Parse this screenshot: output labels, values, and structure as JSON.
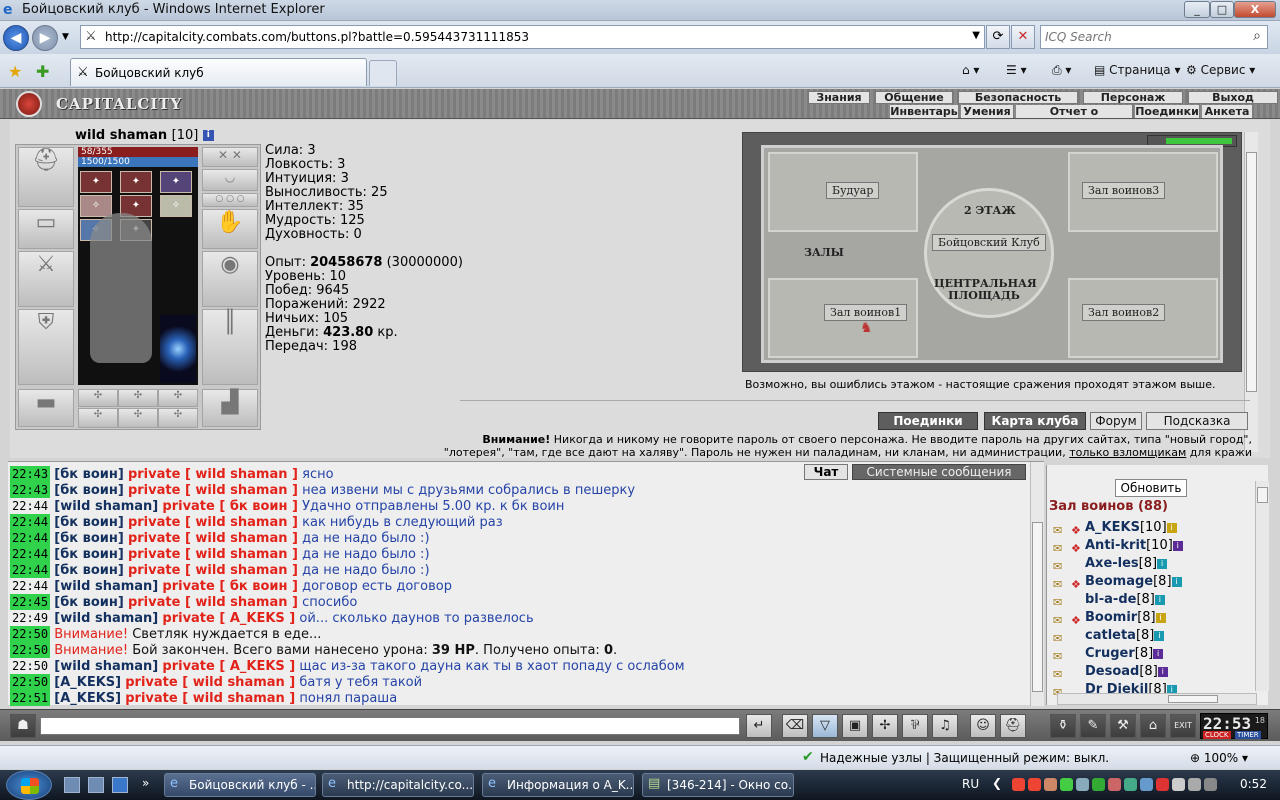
{
  "window": {
    "title": "Бойцовский клуб - Windows Internet Explorer",
    "min": "_",
    "max": "□",
    "close": "X"
  },
  "browser": {
    "url": "http://capitalcity.combats.com/buttons.pl?battle=0.595443731111853",
    "search_placeholder": "ICQ Search",
    "tab_label": "Бойцовский клуб",
    "cmd_page": "Страница",
    "cmd_service": "Сервис",
    "status_text": "Надежные узлы | Защищенный режим: выкл.",
    "zoom": "100%"
  },
  "game": {
    "logo_text": "CAPITALCITY",
    "top_menu": [
      "Знания",
      "Общение",
      "Безопасность",
      "Персонаж",
      "Выход"
    ],
    "sub_menu": [
      "Инвентарь",
      "Умения",
      "Отчет о переводах",
      "Поединки",
      "Анкета"
    ],
    "character": {
      "name": "wild shaman",
      "level": "[10]",
      "hp": "58/355",
      "mp": "1500/1500"
    },
    "stats": {
      "strength": "Сила: 3",
      "agility": "Ловкость: 3",
      "intuition": "Интуиция: 3",
      "endurance": "Выносливость: 25",
      "intellect": "Интеллект: 35",
      "wisdom": "Мудрость: 125",
      "spirit": "Духовность: 0",
      "exp_label": "Опыт: ",
      "exp_value": "20458678",
      "exp_next": " (30000000)",
      "level": "Уровень: 10",
      "wins": "Побед: 9645",
      "losses": "Поражений: 2922",
      "draws": "Ничьих: 105",
      "money_label": "Деньги: ",
      "money_value": "423.80",
      "money_unit": " кр.",
      "transfers": "Передач: 198"
    },
    "map": {
      "boudoir": "Будуар",
      "hall3": "Зал воинов3",
      "floor": "2 ЭТАЖ",
      "club": "Бойцовский Клуб",
      "halls": "ЗАЛЫ",
      "central": "ЦЕНТРАЛЬНАЯ ПЛОЩАДЬ",
      "hall1": "Зал воинов1",
      "hall2": "Зал воинов2",
      "note": "Возможно, вы ошиблись этажом - настоящие сражения проходят этажом выше."
    },
    "buttons": {
      "duels": "Поединки",
      "club_map": "Карта клуба",
      "forum": "Форум",
      "hint": "Подсказка"
    },
    "warning": {
      "bold": "Внимание!",
      "line1": " Никогда и никому не говорите пароль от своего персонажа. Не вводите пароль на других сайтах, типа \"новый город\",",
      "line2_a": "\"лотерея\", \"там, где все дают на халяву\". Пароль не нужен ни паладинам, ни кланам, ни администрации, ",
      "line2_link": "только взломщикам",
      "line2_b": " для кражи"
    }
  },
  "chat": {
    "tab_chat": "Чат",
    "tab_system": "Системные сообщения",
    "lines": [
      {
        "ts": "22:43",
        "hl": true,
        "from": "[бк воин]",
        "priv": "private [ wild shaman ]",
        "text": "ясно"
      },
      {
        "ts": "22:43",
        "hl": true,
        "from": "[бк воин]",
        "priv": "private [ wild shaman ]",
        "text": "неа извени мы с друзьями собрались в пешерку"
      },
      {
        "ts": "22:44",
        "hl": false,
        "from": "[wild shaman]",
        "priv": "private [ бк воин ]",
        "text": "Удачно отправлены 5.00 кр. к бк воин"
      },
      {
        "ts": "22:44",
        "hl": true,
        "from": "[бк воин]",
        "priv": "private [ wild shaman ]",
        "text": "как нибудь в следующий раз"
      },
      {
        "ts": "22:44",
        "hl": true,
        "from": "[бк воин]",
        "priv": "private [ wild shaman ]",
        "text": "да не надо было :)"
      },
      {
        "ts": "22:44",
        "hl": true,
        "from": "[бк воин]",
        "priv": "private [ wild shaman ]",
        "text": "да не надо было :)"
      },
      {
        "ts": "22:44",
        "hl": true,
        "from": "[бк воин]",
        "priv": "private [ wild shaman ]",
        "text": "да не надо было :)"
      },
      {
        "ts": "22:44",
        "hl": false,
        "from": "[wild shaman]",
        "priv": "private [ бк воин ]",
        "text": "договор есть договор"
      },
      {
        "ts": "22:45",
        "hl": true,
        "from": "[бк воин]",
        "priv": "private [ wild shaman ]",
        "text": "спосибо"
      },
      {
        "ts": "22:49",
        "hl": false,
        "from": "[wild shaman]",
        "priv": "private [ A_KEKS ]",
        "text": "ой... сколько даунов то развелось"
      },
      {
        "ts": "22:50",
        "hl": true,
        "sys": "Внимание!",
        "systext": "Светляк нуждается в еде..."
      },
      {
        "ts": "22:50",
        "hl": true,
        "sys": "Внимание!",
        "systext": "Бой закончен. Всего вами нанесено урона: ",
        "b1": "39 HP",
        "t2": ". Получено опыта: ",
        "b2": "0",
        "t3": "."
      },
      {
        "ts": "22:50",
        "hl": false,
        "from": "[wild shaman]",
        "priv": "private [ A_KEKS ]",
        "text": "щас из-за такого дауна как ты в хаот попаду с ослабом"
      },
      {
        "ts": "22:50",
        "hl": true,
        "from": "[A_KEKS]",
        "priv": "private [ wild shaman ]",
        "text": "батя у тебя такой"
      },
      {
        "ts": "22:51",
        "hl": true,
        "from": "[A_KEKS]",
        "priv": "private [ wild shaman ]",
        "text": "понял параша"
      }
    ]
  },
  "online": {
    "refresh_label": "Обновить",
    "room": "Зал воинов (88)",
    "players": [
      {
        "name": "A_KEKS",
        "level": "[10]",
        "badge": "yellow",
        "clan": true
      },
      {
        "name": "Anti-krit",
        "level": "[10]",
        "badge": "purple",
        "clan": true
      },
      {
        "name": "Axe-les",
        "level": "[8]",
        "badge": "teal",
        "clan": false
      },
      {
        "name": "Beomage",
        "level": "[8]",
        "badge": "teal",
        "clan": true
      },
      {
        "name": "bl-a-de",
        "level": "[8]",
        "badge": "teal",
        "clan": false
      },
      {
        "name": "Boomir",
        "level": "[8]",
        "badge": "yellow",
        "clan": true
      },
      {
        "name": "catleta",
        "level": "[8]",
        "badge": "teal",
        "clan": false
      },
      {
        "name": "Cruger",
        "level": "[8]",
        "badge": "purple",
        "clan": false
      },
      {
        "name": "Desoad",
        "level": "[8]",
        "badge": "purple",
        "clan": false
      },
      {
        "name": "Dr Djekil",
        "level": "[8]",
        "badge": "teal",
        "clan": false
      }
    ]
  },
  "toolbar": {
    "clock_time": "22:53",
    "clock_sec": "18",
    "clock_label": "CLOCK",
    "timer_label": "TIMER"
  },
  "taskbar": {
    "tasks": [
      "Бойцовский клуб - ...",
      "http://capitalcity.co...",
      "Информация о A_K...",
      "[346-214] - Окно со..."
    ],
    "lang": "RU",
    "time": "0:52"
  }
}
